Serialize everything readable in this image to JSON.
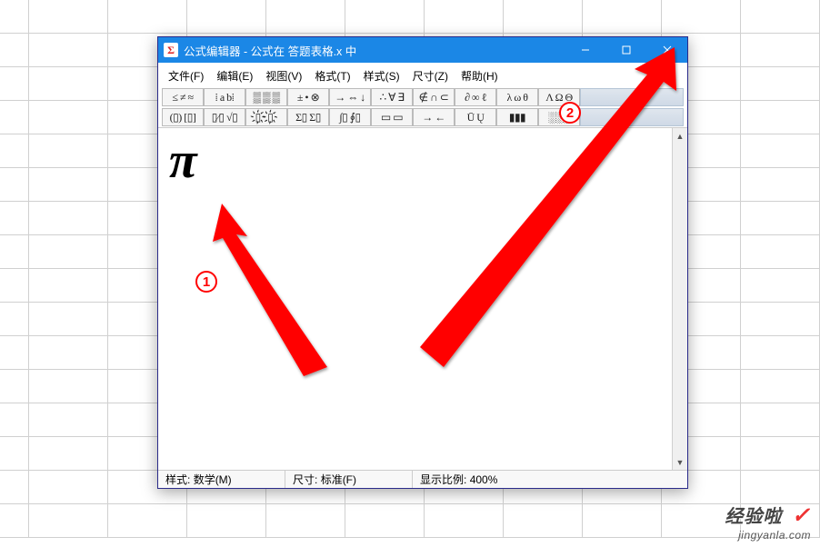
{
  "window": {
    "title": "公式编辑器 - 公式在 答题表格.x 中"
  },
  "menus": {
    "file": "文件(F)",
    "edit": "编辑(E)",
    "view": "视图(V)",
    "format": "格式(T)",
    "style": "样式(S)",
    "size": "尺寸(Z)",
    "help": "帮助(H)"
  },
  "toolbar_row1": [
    "≤ ≠ ≈",
    "⁞ a b⁞",
    "▒ ▒ ▒",
    "± • ⊗",
    "→ ⇔ ↓",
    "∴ ∀ ∃",
    "∉ ∩ ⊂",
    "∂ ∞ ℓ",
    "λ ω θ",
    "Λ Ω Θ"
  ],
  "toolbar_row2": [
    "(▯) [▯]",
    "▯⁄▯ √▯",
    "▯҉  ▯҉",
    "Σ▯ Σ▯",
    "∫▯ ∮▯",
    "▭ ▭",
    "→ ←",
    "Ū Ų",
    "▮▮▮",
    "░░░"
  ],
  "content": {
    "pi": "π"
  },
  "status": {
    "style_label": "样式:",
    "style_value": "数学(M)",
    "size_label": "尺寸:",
    "size_value": "标准(F)",
    "zoom_label": "显示比例:",
    "zoom_value": "400%"
  },
  "badges": {
    "one": "1",
    "two": "2"
  },
  "watermark": {
    "title": "经验啦",
    "check": "✓",
    "sub": "jingyanla.com"
  }
}
